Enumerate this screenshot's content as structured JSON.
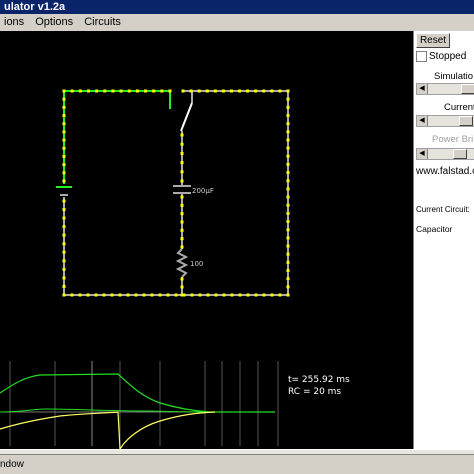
{
  "window": {
    "title": "ulator v1.2a"
  },
  "menu": [
    {
      "label": "ions"
    },
    {
      "label": "Options"
    },
    {
      "label": "Circuits"
    }
  ],
  "panel": {
    "reset_label": "Reset",
    "stopped_label": "Stopped",
    "sim_speed_label": "Simulatio",
    "current_speed_label": "Current",
    "power_brightness_label": "Power Bri",
    "url": "www.falstad.c",
    "current_circuit_label": "Current Circuit:",
    "circuit_name": "Capacitor"
  },
  "circuit": {
    "capacitor_value": "200µF",
    "resistor_value": "100",
    "colors": {
      "wire_current": "#22ee22",
      "wire_neutral": "#aaaaaa",
      "dots": "#ffff00"
    }
  },
  "scope": {
    "time_readout": "t= 255.92 ms",
    "rc_readout": "RC = 20 ms",
    "colors": {
      "voltage": "#22dd22",
      "current": "#ffff66",
      "grid": "#555555"
    }
  },
  "status": {
    "text": "ndow"
  }
}
